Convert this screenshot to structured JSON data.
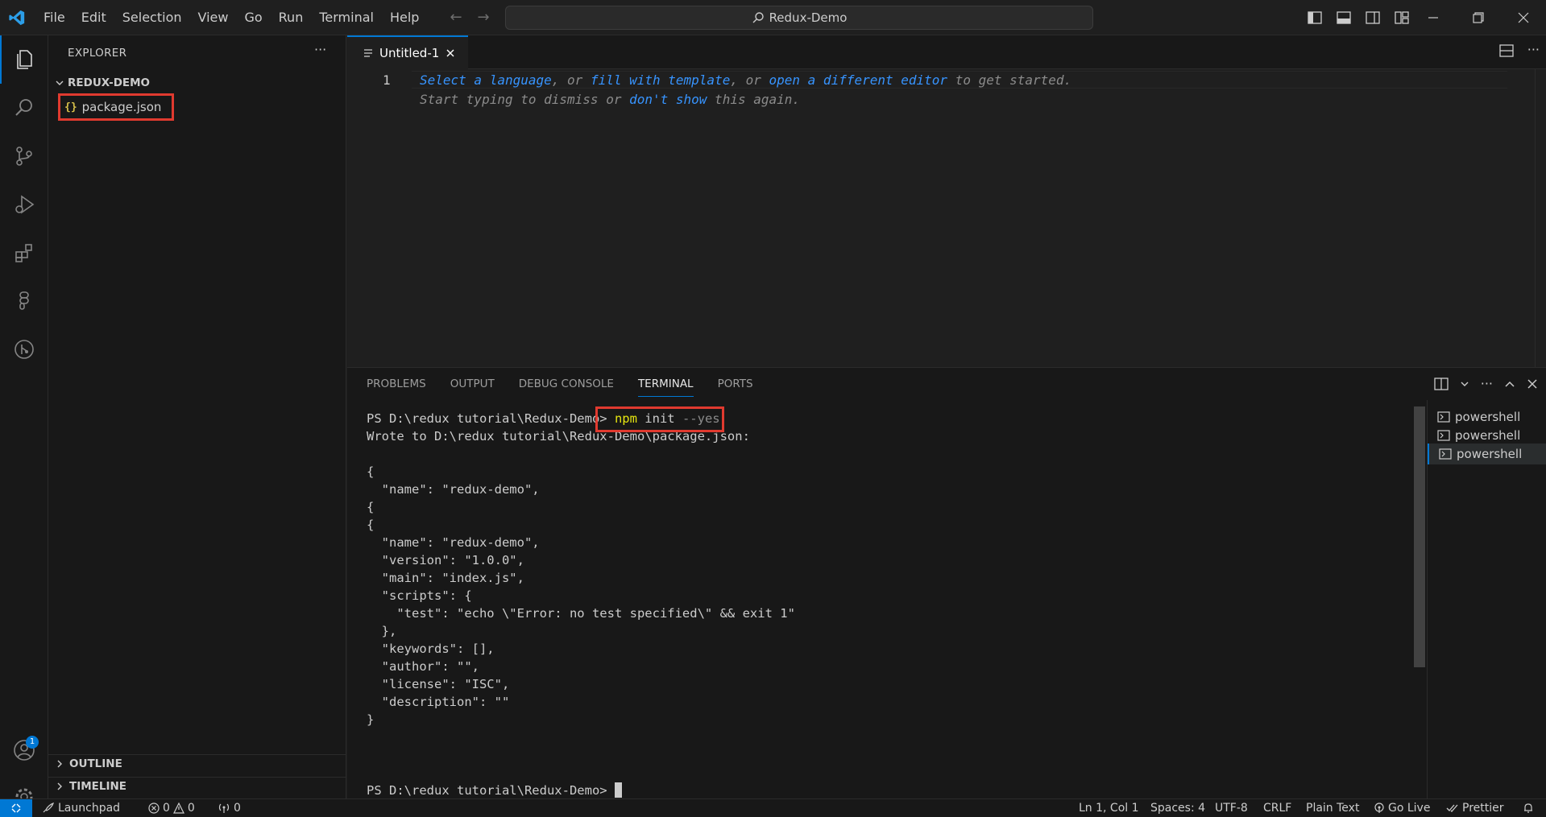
{
  "menu": [
    "File",
    "Edit",
    "Selection",
    "View",
    "Go",
    "Run",
    "Terminal",
    "Help"
  ],
  "search": {
    "label": "Redux-Demo"
  },
  "sidebar": {
    "title": "EXPLORER",
    "folder": "REDUX-DEMO",
    "file": {
      "icon": "{}",
      "name": "package.json"
    },
    "outline": "OUTLINE",
    "timeline": "TIMELINE"
  },
  "accounts_badge": "1",
  "editor": {
    "tab_label": "Untitled-1",
    "line_number": "1",
    "hint1": {
      "link1": "Select a language",
      "sep1": ", or ",
      "link2": "fill with template",
      "sep2": ", or ",
      "link3": "open a different editor",
      "rest": " to get started."
    },
    "hint2": {
      "text": "Start typing to dismiss or ",
      "link": "don't show",
      "rest": " this again."
    }
  },
  "panel": {
    "tabs": [
      "PROBLEMS",
      "OUTPUT",
      "DEBUG CONSOLE",
      "TERMINAL",
      "PORTS"
    ],
    "active_tab": "TERMINAL",
    "prompt": "PS D:\\redux tutorial\\Redux-Demo>",
    "command": {
      "npm": "npm",
      "rest": " init ",
      "flag": "--yes"
    },
    "output": [
      "Wrote to D:\\redux tutorial\\Redux-Demo\\package.json:",
      "",
      "{",
      "  \"name\": \"redux-demo\",",
      "{",
      "{",
      "  \"name\": \"redux-demo\",",
      "  \"version\": \"1.0.0\",",
      "  \"main\": \"index.js\",",
      "  \"scripts\": {",
      "    \"test\": \"echo \\\"Error: no test specified\\\" && exit 1\"",
      "  },",
      "  \"keywords\": [],",
      "  \"author\": \"\",",
      "  \"license\": \"ISC\",",
      "  \"description\": \"\"",
      "}",
      "",
      "",
      ""
    ],
    "terminals": [
      "powershell",
      "powershell",
      "powershell"
    ]
  },
  "status": {
    "launchpad": "Launchpad",
    "errors": "0",
    "warnings": "0",
    "ports": "0",
    "position": "Ln 1, Col 1",
    "spaces": "Spaces: 4",
    "encoding": "UTF-8",
    "eol": "CRLF",
    "language": "Plain Text",
    "golive": "Go Live",
    "prettier": "Prettier"
  },
  "colors": {
    "accent": "#0078d4",
    "highlight_box": "#e03a2f",
    "link": "#3794ff"
  }
}
